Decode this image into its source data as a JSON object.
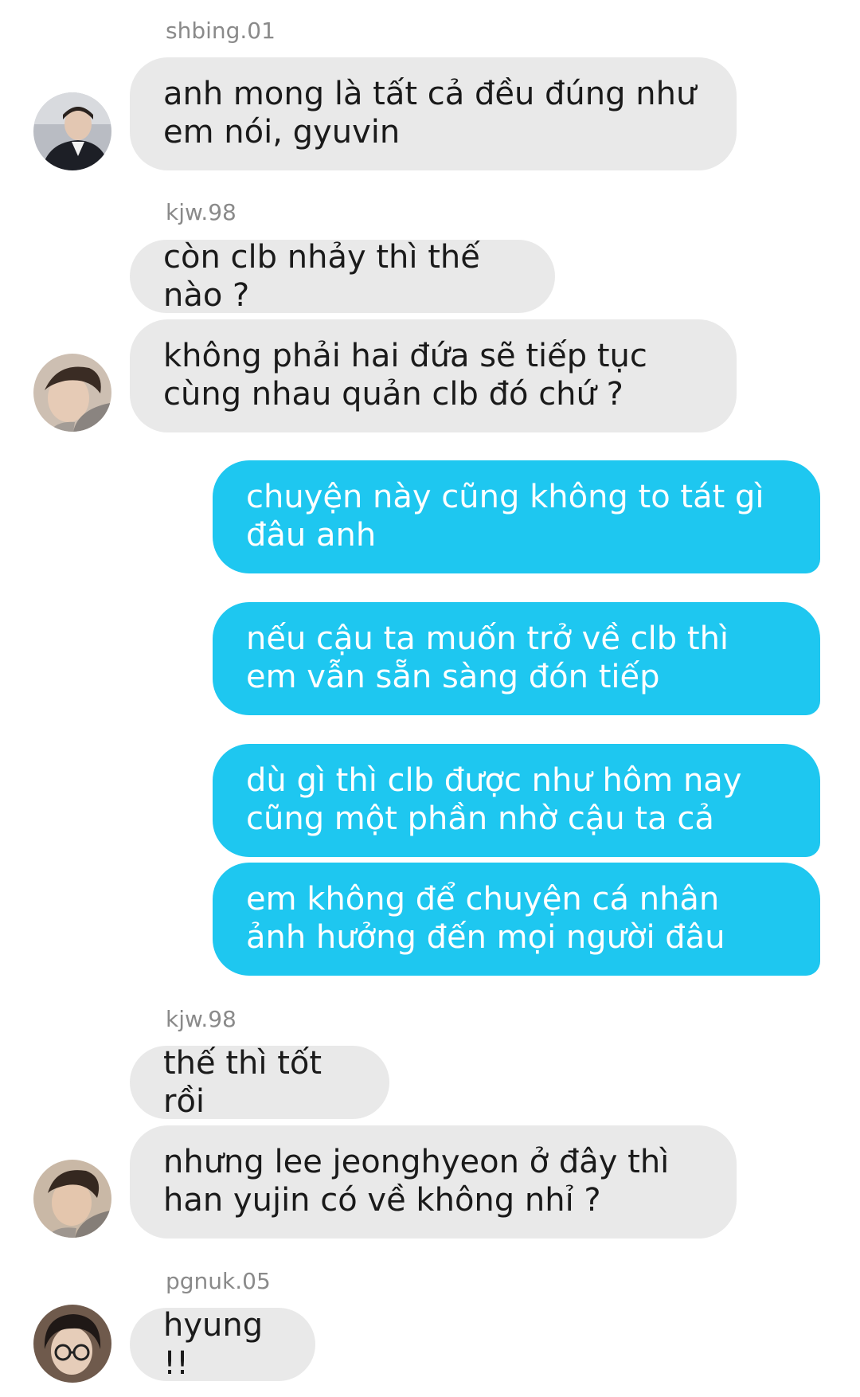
{
  "messages": [
    {
      "sender": "shbing.01",
      "text": "anh mong là tất cả đều đúng như em nói, gyuvin"
    },
    {
      "sender": "kjw.98",
      "text": "còn clb nhảy thì thế nào ?"
    },
    {
      "text": "không phải hai đứa sẽ tiếp tục cùng nhau quản clb đó chứ ?"
    },
    {
      "text": "chuyện này cũng không to tát gì đâu anh",
      "outgoing": true
    },
    {
      "text": "nếu cậu ta muốn trở về clb thì em vẫn sẵn sàng đón tiếp",
      "outgoing": true
    },
    {
      "text": "dù gì thì clb được như hôm nay cũng một phần nhờ cậu ta cả",
      "outgoing": true
    },
    {
      "text": "em không để chuyện cá nhân ảnh hưởng đến mọi người đâu",
      "outgoing": true
    },
    {
      "sender": "kjw.98",
      "text": "thế thì tốt rồi"
    },
    {
      "text": "nhưng lee jeonghyeon ở đây thì han yujin có về không nhỉ ?"
    },
    {
      "sender": "pgnuk.05",
      "text": "hyung !!"
    }
  ],
  "avatars": [
    {
      "user": "shbing.01",
      "icon": "user-avatar-photo"
    },
    {
      "user": "kjw.98",
      "icon": "user-avatar-photo"
    },
    {
      "user": "kjw.98",
      "icon": "user-avatar-photo"
    },
    {
      "user": "pgnuk.05",
      "icon": "user-avatar-photo"
    }
  ],
  "colors": {
    "incoming_bubble": "#e9e9e9",
    "outgoing_bubble": "#1ec7f0",
    "sender_name": "#8a8a8a"
  }
}
